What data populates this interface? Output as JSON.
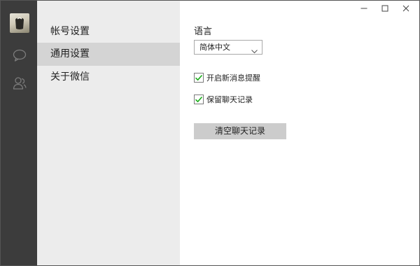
{
  "rail": {
    "avatar": "user-avatar",
    "icons": [
      "chat-icon",
      "contacts-icon"
    ]
  },
  "menu": {
    "items": [
      {
        "label": "帐号设置",
        "active": false
      },
      {
        "label": "通用设置",
        "active": true
      },
      {
        "label": "关于微信",
        "active": false
      }
    ]
  },
  "window_controls": [
    "minimize-icon",
    "maximize-icon",
    "close-icon"
  ],
  "settings": {
    "language_label": "语言",
    "language_value": "简体中文",
    "checkboxes": [
      {
        "label": "开启新消息提醒",
        "checked": true
      },
      {
        "label": "保留聊天记录",
        "checked": true
      }
    ],
    "clear_button_label": "清空聊天记录"
  },
  "colors": {
    "rail_bg": "#3c3c3c",
    "menu_bg": "#ececec",
    "menu_active_bg": "#d4d4d4",
    "check_green": "#1aad19",
    "button_bg": "#cccccc"
  }
}
